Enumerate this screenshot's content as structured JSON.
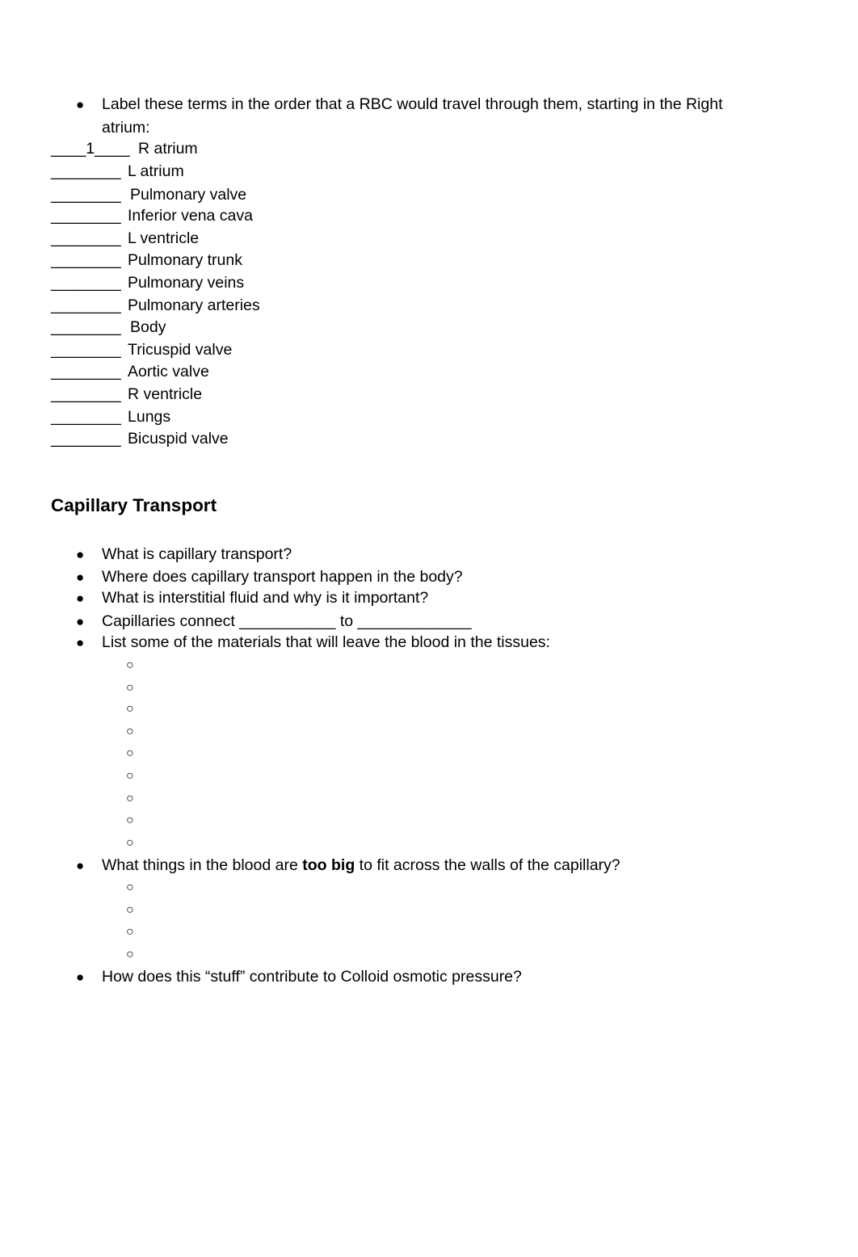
{
  "section1": {
    "instruction_line1": "Label these terms in the order that a RBC would travel through them, starting in the Right",
    "instruction_line2": "atrium:",
    "items": [
      {
        "blank": "____1____",
        "term": "R atrium"
      },
      {
        "blank": "________",
        "term": "L atrium"
      },
      {
        "blank": "________",
        "term": "Pulmonary valve"
      },
      {
        "blank": "________",
        "term": "Inferior vena cava"
      },
      {
        "blank": "________",
        "term": "L ventricle"
      },
      {
        "blank": "________",
        "term": "Pulmonary trunk"
      },
      {
        "blank": "________",
        "term": "Pulmonary veins"
      },
      {
        "blank": "________",
        "term": "Pulmonary arteries"
      },
      {
        "blank": "________",
        "term": "Body"
      },
      {
        "blank": "________",
        "term": "Tricuspid valve"
      },
      {
        "blank": "________",
        "term": "Aortic valve"
      },
      {
        "blank": "________",
        "term": "R ventricle"
      },
      {
        "blank": "________",
        "term": "Lungs"
      },
      {
        "blank": "________",
        "term": "Bicuspid valve"
      }
    ]
  },
  "section2": {
    "heading": "Capillary Transport",
    "q1": "What is capillary transport?",
    "q2": "Where does capillary transport happen in the body?",
    "q3": "What is interstitial fluid and why is it important?",
    "q4": "Capillaries connect ___________ to _____________",
    "q5": "List some of the materials that will leave the blood in the tissues:",
    "q6_pre": "What things in the blood are ",
    "q6_bold": "too big",
    "q6_post": " to fit across the walls of the capillary?",
    "q7": "How does this “stuff” contribute to Colloid osmotic pressure?",
    "bullet_glyph": "●",
    "sub_bullet_glyph": "○"
  }
}
